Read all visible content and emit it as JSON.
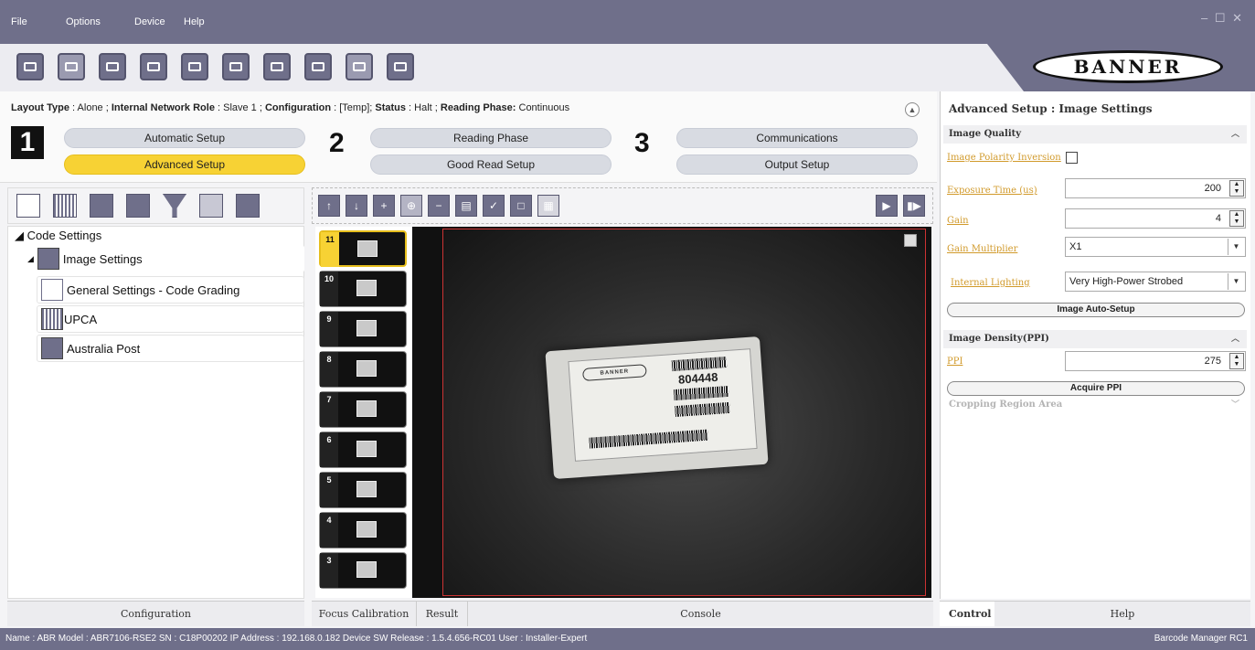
{
  "menu": {
    "file": "File",
    "options": "Options",
    "device": "Device",
    "help": "Help"
  },
  "window_controls": "– ☐ ✕",
  "logo_text": "BANNER",
  "infoline": {
    "layout_type_label": "Layout Type",
    "layout_type_value": " : Alone ; ",
    "network_role_label": "Internal Network Role",
    "network_role_value": " : Slave 1 ; ",
    "configuration_label": "Configuration",
    "configuration_value": " : [Temp]; ",
    "status_label": "Status",
    "status_value": " : Halt ; ",
    "reading_phase_label": "Reading Phase:",
    "reading_phase_value": " Continuous"
  },
  "phases": {
    "step1": "1",
    "step2": "2",
    "step3": "3",
    "automatic_setup": "Automatic Setup",
    "advanced_setup": "Advanced Setup",
    "reading_phase": "Reading Phase",
    "good_read_setup": "Good Read Setup",
    "communications": "Communications",
    "output_setup": "Output Setup"
  },
  "tree": {
    "code_settings": "◢ Code Settings",
    "image_settings": "Image Settings",
    "general_settings": "General Settings - Code Grading",
    "upca": "UPCA",
    "australia_post": "Australia Post"
  },
  "left_tab": "Configuration",
  "thumbnails": [
    "11",
    "10",
    "9",
    "8",
    "7",
    "6",
    "5",
    "4",
    "3"
  ],
  "package_label": {
    "brand": "BANNER",
    "number": "804448"
  },
  "center_tabs": {
    "focus_calibration": "Focus Calibration",
    "result": "Result",
    "console": "Console"
  },
  "right_panel": {
    "title": "Advanced Setup :  Image Settings",
    "image_quality": "Image Quality",
    "image_polarity_inversion": "Image Polarity Inversion",
    "exposure_time_label": "Exposure Time (us)",
    "exposure_time_value": "200",
    "gain_label": "Gain",
    "gain_value": "4",
    "gain_multiplier_label": "Gain Multiplier",
    "gain_multiplier_value": "X1",
    "internal_lighting_label": "Internal Lighting",
    "internal_lighting_value": "Very High-Power Strobed",
    "image_auto_setup": "Image Auto-Setup",
    "image_density": "Image Density(PPI)",
    "ppi_label": "PPI",
    "ppi_value": "275",
    "acquire_ppi": "Acquire PPI",
    "cropping_region_area": "Cropping Region Area"
  },
  "right_tabs": {
    "control": "Control",
    "help": "Help"
  },
  "status": {
    "left": "Name : ABR   Model : ABR7106-RSE2   SN : C18P00202   IP Address :  192.168.0.182   Device SW Release : 1.5.4.656-RC01   User : Installer-Expert",
    "right": "Barcode Manager RC1"
  }
}
